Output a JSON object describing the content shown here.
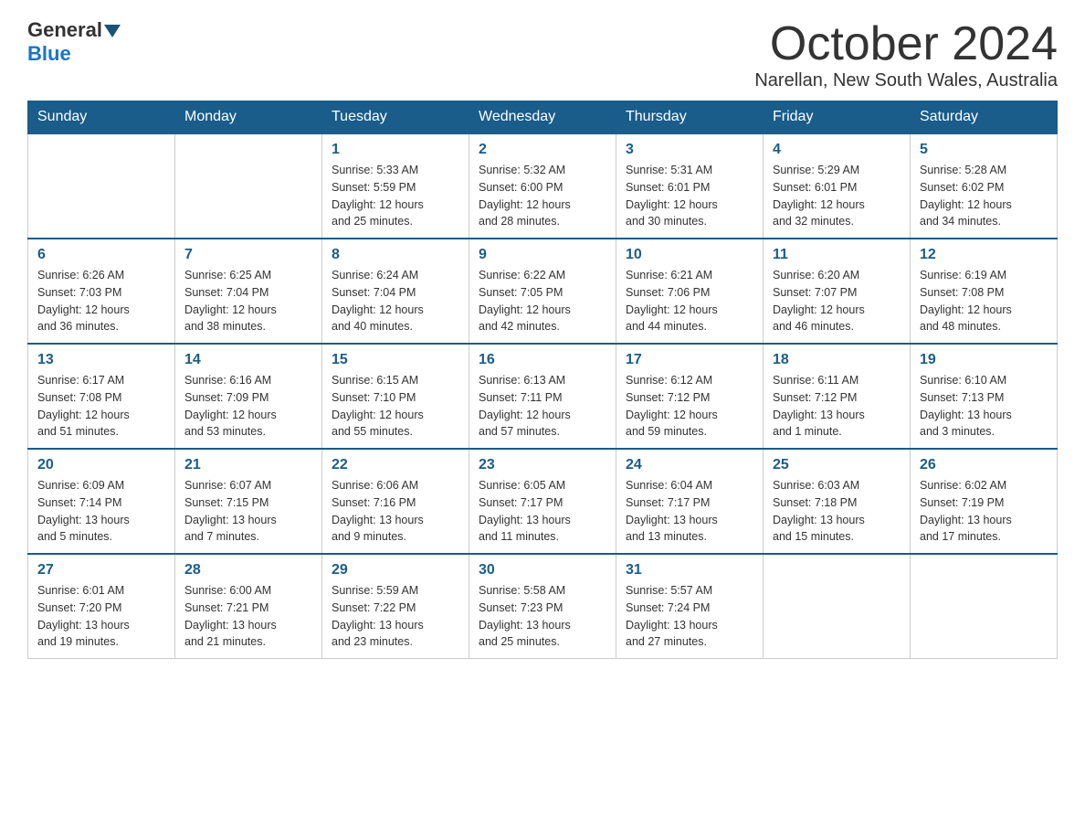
{
  "logo": {
    "general": "General",
    "blue": "Blue",
    "triangle": "▼"
  },
  "title": "October 2024",
  "subtitle": "Narellan, New South Wales, Australia",
  "calendar": {
    "headers": [
      "Sunday",
      "Monday",
      "Tuesday",
      "Wednesday",
      "Thursday",
      "Friday",
      "Saturday"
    ],
    "weeks": [
      [
        {
          "day": "",
          "info": ""
        },
        {
          "day": "",
          "info": ""
        },
        {
          "day": "1",
          "info": "Sunrise: 5:33 AM\nSunset: 5:59 PM\nDaylight: 12 hours\nand 25 minutes."
        },
        {
          "day": "2",
          "info": "Sunrise: 5:32 AM\nSunset: 6:00 PM\nDaylight: 12 hours\nand 28 minutes."
        },
        {
          "day": "3",
          "info": "Sunrise: 5:31 AM\nSunset: 6:01 PM\nDaylight: 12 hours\nand 30 minutes."
        },
        {
          "day": "4",
          "info": "Sunrise: 5:29 AM\nSunset: 6:01 PM\nDaylight: 12 hours\nand 32 minutes."
        },
        {
          "day": "5",
          "info": "Sunrise: 5:28 AM\nSunset: 6:02 PM\nDaylight: 12 hours\nand 34 minutes."
        }
      ],
      [
        {
          "day": "6",
          "info": "Sunrise: 6:26 AM\nSunset: 7:03 PM\nDaylight: 12 hours\nand 36 minutes."
        },
        {
          "day": "7",
          "info": "Sunrise: 6:25 AM\nSunset: 7:04 PM\nDaylight: 12 hours\nand 38 minutes."
        },
        {
          "day": "8",
          "info": "Sunrise: 6:24 AM\nSunset: 7:04 PM\nDaylight: 12 hours\nand 40 minutes."
        },
        {
          "day": "9",
          "info": "Sunrise: 6:22 AM\nSunset: 7:05 PM\nDaylight: 12 hours\nand 42 minutes."
        },
        {
          "day": "10",
          "info": "Sunrise: 6:21 AM\nSunset: 7:06 PM\nDaylight: 12 hours\nand 44 minutes."
        },
        {
          "day": "11",
          "info": "Sunrise: 6:20 AM\nSunset: 7:07 PM\nDaylight: 12 hours\nand 46 minutes."
        },
        {
          "day": "12",
          "info": "Sunrise: 6:19 AM\nSunset: 7:08 PM\nDaylight: 12 hours\nand 48 minutes."
        }
      ],
      [
        {
          "day": "13",
          "info": "Sunrise: 6:17 AM\nSunset: 7:08 PM\nDaylight: 12 hours\nand 51 minutes."
        },
        {
          "day": "14",
          "info": "Sunrise: 6:16 AM\nSunset: 7:09 PM\nDaylight: 12 hours\nand 53 minutes."
        },
        {
          "day": "15",
          "info": "Sunrise: 6:15 AM\nSunset: 7:10 PM\nDaylight: 12 hours\nand 55 minutes."
        },
        {
          "day": "16",
          "info": "Sunrise: 6:13 AM\nSunset: 7:11 PM\nDaylight: 12 hours\nand 57 minutes."
        },
        {
          "day": "17",
          "info": "Sunrise: 6:12 AM\nSunset: 7:12 PM\nDaylight: 12 hours\nand 59 minutes."
        },
        {
          "day": "18",
          "info": "Sunrise: 6:11 AM\nSunset: 7:12 PM\nDaylight: 13 hours\nand 1 minute."
        },
        {
          "day": "19",
          "info": "Sunrise: 6:10 AM\nSunset: 7:13 PM\nDaylight: 13 hours\nand 3 minutes."
        }
      ],
      [
        {
          "day": "20",
          "info": "Sunrise: 6:09 AM\nSunset: 7:14 PM\nDaylight: 13 hours\nand 5 minutes."
        },
        {
          "day": "21",
          "info": "Sunrise: 6:07 AM\nSunset: 7:15 PM\nDaylight: 13 hours\nand 7 minutes."
        },
        {
          "day": "22",
          "info": "Sunrise: 6:06 AM\nSunset: 7:16 PM\nDaylight: 13 hours\nand 9 minutes."
        },
        {
          "day": "23",
          "info": "Sunrise: 6:05 AM\nSunset: 7:17 PM\nDaylight: 13 hours\nand 11 minutes."
        },
        {
          "day": "24",
          "info": "Sunrise: 6:04 AM\nSunset: 7:17 PM\nDaylight: 13 hours\nand 13 minutes."
        },
        {
          "day": "25",
          "info": "Sunrise: 6:03 AM\nSunset: 7:18 PM\nDaylight: 13 hours\nand 15 minutes."
        },
        {
          "day": "26",
          "info": "Sunrise: 6:02 AM\nSunset: 7:19 PM\nDaylight: 13 hours\nand 17 minutes."
        }
      ],
      [
        {
          "day": "27",
          "info": "Sunrise: 6:01 AM\nSunset: 7:20 PM\nDaylight: 13 hours\nand 19 minutes."
        },
        {
          "day": "28",
          "info": "Sunrise: 6:00 AM\nSunset: 7:21 PM\nDaylight: 13 hours\nand 21 minutes."
        },
        {
          "day": "29",
          "info": "Sunrise: 5:59 AM\nSunset: 7:22 PM\nDaylight: 13 hours\nand 23 minutes."
        },
        {
          "day": "30",
          "info": "Sunrise: 5:58 AM\nSunset: 7:23 PM\nDaylight: 13 hours\nand 25 minutes."
        },
        {
          "day": "31",
          "info": "Sunrise: 5:57 AM\nSunset: 7:24 PM\nDaylight: 13 hours\nand 27 minutes."
        },
        {
          "day": "",
          "info": ""
        },
        {
          "day": "",
          "info": ""
        }
      ]
    ]
  }
}
